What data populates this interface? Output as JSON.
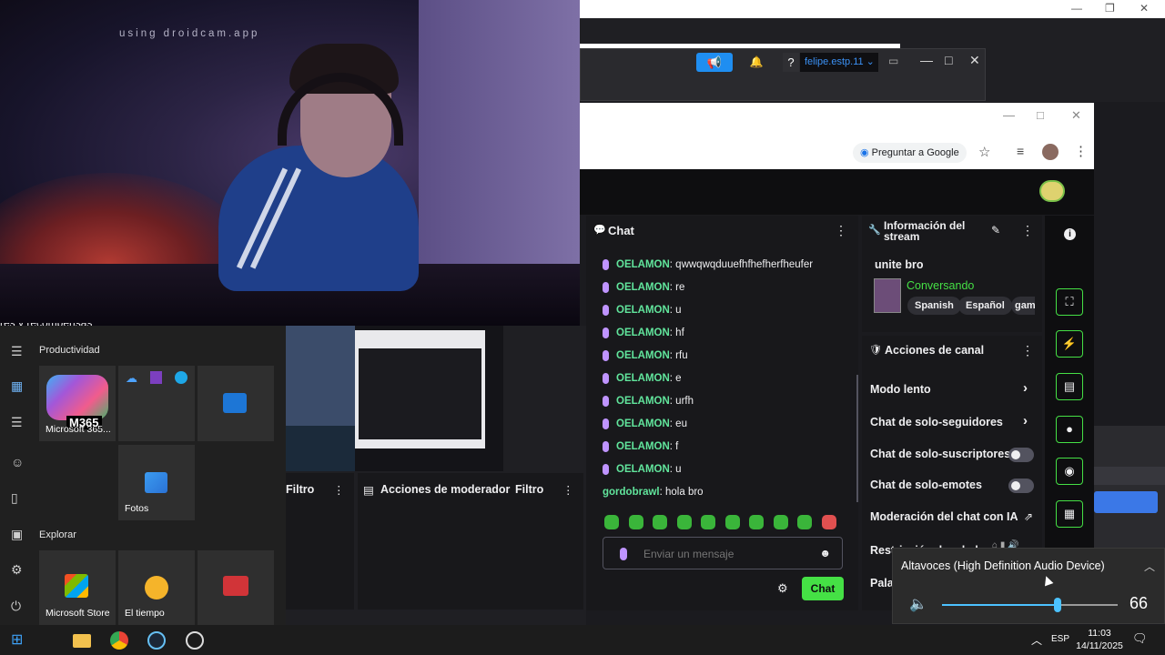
{
  "webcam": {
    "watermark": "using droidcam.app",
    "bottom_text": "res y recompensas"
  },
  "dashboard_toolbar": {
    "user": "felipe.estp.11",
    "help": "?"
  },
  "browser": {
    "ask_google": "Preguntar a Google"
  },
  "chat": {
    "title": "Chat",
    "messages": [
      {
        "user": "OELAMON",
        "text": ": qwwqwqduuefhfhefherfheufer",
        "badge": true
      },
      {
        "user": "OELAMON",
        "text": ": re",
        "badge": true
      },
      {
        "user": "OELAMON",
        "text": ": u",
        "badge": true
      },
      {
        "user": "OELAMON",
        "text": ": hf",
        "badge": true
      },
      {
        "user": "OELAMON",
        "text": ": rfu",
        "badge": true
      },
      {
        "user": "OELAMON",
        "text": ": e",
        "badge": true
      },
      {
        "user": "OELAMON",
        "text": ": urfh",
        "badge": true
      },
      {
        "user": "OELAMON",
        "text": ": eu",
        "badge": true
      },
      {
        "user": "OELAMON",
        "text": ": f",
        "badge": true
      },
      {
        "user": "OELAMON",
        "text": ": u",
        "badge": true
      },
      {
        "user": "gordobrawl",
        "text": ": hola bro",
        "badge": false
      }
    ],
    "input_placeholder": "Enviar un mensaje",
    "send_label": "Chat"
  },
  "stream_info": {
    "title": "Información del stream",
    "stream_title": "unite bro",
    "category": "Conversando",
    "tags": [
      "Spanish",
      "Español",
      "gaming"
    ]
  },
  "channel_actions": {
    "title": "Acciones de canal",
    "items": [
      {
        "label": "Modo lento",
        "kind": "arrow"
      },
      {
        "label": "Chat de solo-seguidores",
        "kind": "arrow"
      },
      {
        "label": "Chat de solo-suscriptores",
        "kind": "toggle"
      },
      {
        "label": "Chat de solo-emotes",
        "kind": "toggle"
      },
      {
        "label": "Moderación del chat con IA",
        "kind": "external"
      },
      {
        "label": "Restricción de edad",
        "kind": "none"
      },
      {
        "label": "Pala",
        "kind": "none"
      }
    ]
  },
  "start_menu": {
    "section_productivity": "Productividad",
    "section_explore": "Explorar",
    "tiles": {
      "m365_badge": "M365",
      "m365_label": "Microsoft 365...",
      "photos": "Fotos",
      "store": "Microsoft Store",
      "weather": "El tiempo"
    }
  },
  "obs_docks": {
    "filtro1": "Filtro",
    "mod_actions": "Acciones de moderador",
    "filtro2": "Filtro"
  },
  "volume": {
    "device": "Altavoces (High Definition Audio Device)",
    "level": 66,
    "level_text": "66"
  },
  "taskbar": {
    "lang": "ESP",
    "time": "11:03",
    "date": "14/11/2025"
  }
}
